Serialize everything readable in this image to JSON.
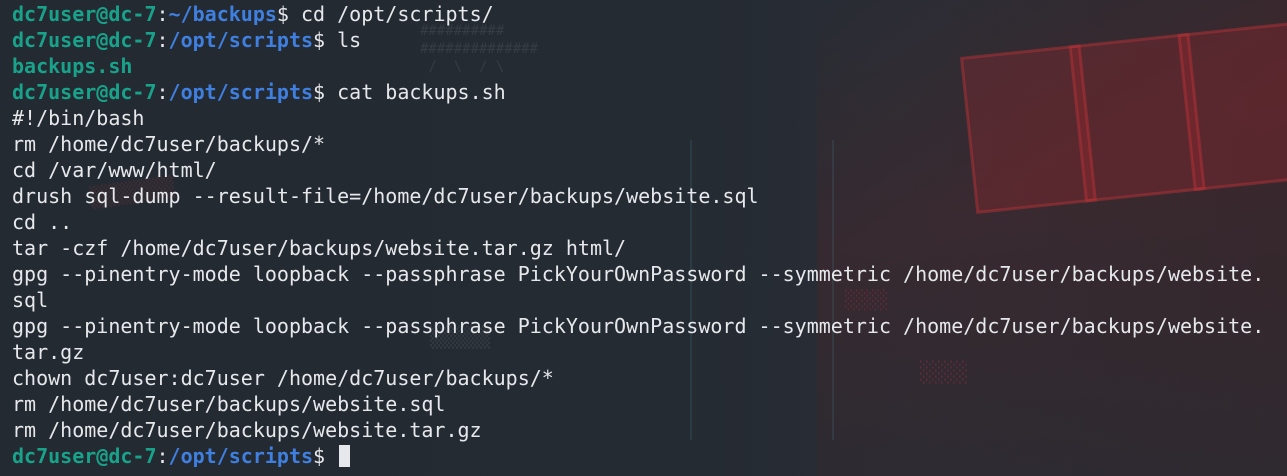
{
  "prompt": {
    "user": "dc7user",
    "host": "dc-7"
  },
  "lines": [
    {
      "type": "prompt",
      "path": "~/backups",
      "command": "cd /opt/scripts/"
    },
    {
      "type": "prompt",
      "path": "/opt/scripts",
      "command": "ls"
    },
    {
      "type": "ls",
      "text": "backups.sh"
    },
    {
      "type": "prompt",
      "path": "/opt/scripts",
      "command": "cat backups.sh"
    },
    {
      "type": "out",
      "text": "#!/bin/bash"
    },
    {
      "type": "out",
      "text": "rm /home/dc7user/backups/*"
    },
    {
      "type": "out",
      "text": "cd /var/www/html/"
    },
    {
      "type": "out",
      "text": "drush sql-dump --result-file=/home/dc7user/backups/website.sql"
    },
    {
      "type": "out",
      "text": "cd .."
    },
    {
      "type": "out",
      "text": "tar -czf /home/dc7user/backups/website.tar.gz html/"
    },
    {
      "type": "out",
      "text": "gpg --pinentry-mode loopback --passphrase PickYourOwnPassword --symmetric /home/dc7user/backups/website."
    },
    {
      "type": "out",
      "text": "sql"
    },
    {
      "type": "out",
      "text": "gpg --pinentry-mode loopback --passphrase PickYourOwnPassword --symmetric /home/dc7user/backups/website."
    },
    {
      "type": "out",
      "text": "tar.gz"
    },
    {
      "type": "out",
      "text": "chown dc7user:dc7user /home/dc7user/backups/*"
    },
    {
      "type": "out",
      "text": "rm /home/dc7user/backups/website.sql"
    },
    {
      "type": "out",
      "text": "rm /home/dc7user/backups/website.tar.gz"
    },
    {
      "type": "prompt",
      "path": "/opt/scripts",
      "command": ""
    }
  ],
  "colors": {
    "background": "#232a33",
    "user": "#19a28a",
    "path": "#3f7fe0",
    "text": "#e6e8eb",
    "wallpaper_accent": "#aa282d"
  }
}
